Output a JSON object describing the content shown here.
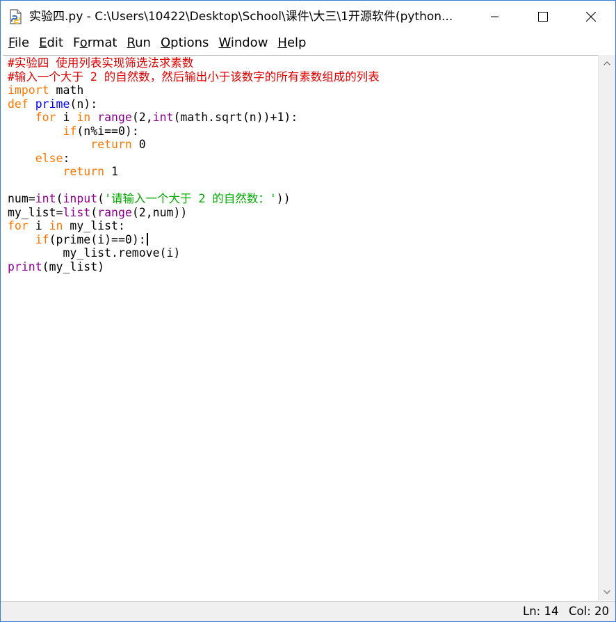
{
  "window": {
    "title": "实验四.py - C:\\Users\\10422\\Desktop\\School\\课件\\大三\\1开源软件(python...",
    "icon": "python-file-icon"
  },
  "menubar": {
    "items": [
      {
        "accel": "F",
        "rest": "ile"
      },
      {
        "accel": "E",
        "rest": "dit"
      },
      {
        "pre": "F",
        "accel": "o",
        "rest": "rmat"
      },
      {
        "accel": "R",
        "rest": "un"
      },
      {
        "accel": "O",
        "rest": "ptions"
      },
      {
        "accel": "W",
        "rest": "indow"
      },
      {
        "accel": "H",
        "rest": "elp"
      }
    ]
  },
  "editor": {
    "lines": [
      [
        {
          "t": "#实验四 使用列表实现筛选法求素数",
          "c": "comment"
        }
      ],
      [
        {
          "t": "#输入一个大于 2 的自然数，然后输出小于该数字的所有素数组成的列表",
          "c": "comment"
        }
      ],
      [
        {
          "t": "import",
          "c": "keyword"
        },
        {
          "t": " math",
          "c": "plain"
        }
      ],
      [
        {
          "t": "def",
          "c": "keyword"
        },
        {
          "t": " ",
          "c": "plain"
        },
        {
          "t": "prime",
          "c": "def"
        },
        {
          "t": "(n):",
          "c": "plain"
        }
      ],
      [
        {
          "t": "    ",
          "c": "plain"
        },
        {
          "t": "for",
          "c": "keyword"
        },
        {
          "t": " i ",
          "c": "plain"
        },
        {
          "t": "in",
          "c": "keyword"
        },
        {
          "t": " ",
          "c": "plain"
        },
        {
          "t": "range",
          "c": "builtin"
        },
        {
          "t": "(2,",
          "c": "plain"
        },
        {
          "t": "int",
          "c": "builtin"
        },
        {
          "t": "(math.sqrt(n))+1):",
          "c": "plain"
        }
      ],
      [
        {
          "t": "        ",
          "c": "plain"
        },
        {
          "t": "if",
          "c": "keyword"
        },
        {
          "t": "(n%i==0):",
          "c": "plain"
        }
      ],
      [
        {
          "t": "            ",
          "c": "plain"
        },
        {
          "t": "return",
          "c": "keyword"
        },
        {
          "t": " 0",
          "c": "plain"
        }
      ],
      [
        {
          "t": "    ",
          "c": "plain"
        },
        {
          "t": "else",
          "c": "keyword"
        },
        {
          "t": ":",
          "c": "plain"
        }
      ],
      [
        {
          "t": "        ",
          "c": "plain"
        },
        {
          "t": "return",
          "c": "keyword"
        },
        {
          "t": " 1",
          "c": "plain"
        }
      ],
      [],
      [
        {
          "t": "num=",
          "c": "plain"
        },
        {
          "t": "int",
          "c": "builtin"
        },
        {
          "t": "(",
          "c": "plain"
        },
        {
          "t": "input",
          "c": "builtin"
        },
        {
          "t": "(",
          "c": "plain"
        },
        {
          "t": "'请输入一个大于 2 的自然数：'",
          "c": "string"
        },
        {
          "t": "))",
          "c": "plain"
        }
      ],
      [
        {
          "t": "my_list=",
          "c": "plain"
        },
        {
          "t": "list",
          "c": "builtin"
        },
        {
          "t": "(",
          "c": "plain"
        },
        {
          "t": "range",
          "c": "builtin"
        },
        {
          "t": "(2,num))",
          "c": "plain"
        }
      ],
      [
        {
          "t": "for",
          "c": "keyword"
        },
        {
          "t": " i ",
          "c": "plain"
        },
        {
          "t": "in",
          "c": "keyword"
        },
        {
          "t": " my_list:",
          "c": "plain"
        }
      ],
      [
        {
          "t": "    ",
          "c": "plain"
        },
        {
          "t": "if",
          "c": "keyword"
        },
        {
          "t": "(prime(i)==0):",
          "c": "plain"
        },
        {
          "caret": true
        }
      ],
      [
        {
          "t": "        my_list.remove(i)",
          "c": "plain"
        }
      ],
      [
        {
          "t": "print",
          "c": "builtin"
        },
        {
          "t": "(my_list)",
          "c": "plain"
        }
      ]
    ]
  },
  "statusbar": {
    "line": "Ln: 14",
    "col": "Col: 20"
  },
  "colors": {
    "comment": "#dd0000",
    "keyword": "#ff7700",
    "builtin": "#900090",
    "def": "#0000ff",
    "string": "#00aa00"
  }
}
